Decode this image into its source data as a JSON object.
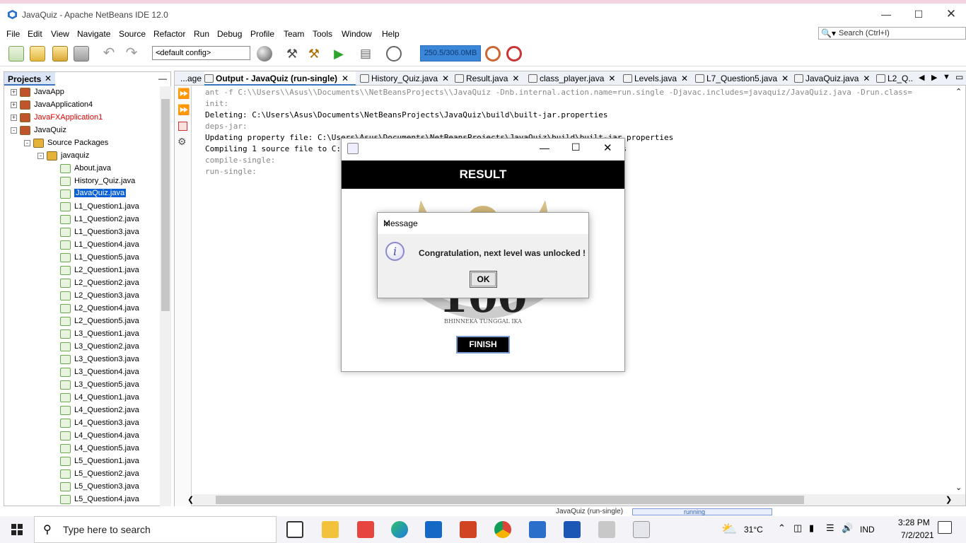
{
  "window": {
    "title": "JavaQuiz - Apache NetBeans IDE 12.0"
  },
  "menu": [
    "File",
    "Edit",
    "View",
    "Navigate",
    "Source",
    "Refactor",
    "Run",
    "Debug",
    "Profile",
    "Team",
    "Tools",
    "Window",
    "Help"
  ],
  "search": {
    "placeholder": "Search (Ctrl+I)"
  },
  "toolbar": {
    "config": "<default config>",
    "memory": "250.5/306.0MB"
  },
  "projects": {
    "tab_label": "Projects",
    "items": [
      {
        "label": "JavaApp",
        "level": 0,
        "expander": "+",
        "color": "#000000"
      },
      {
        "label": "JavaApplication4",
        "level": 0,
        "expander": "+",
        "color": "#000000"
      },
      {
        "label": "JavaFXApplication1",
        "level": 0,
        "expander": "+",
        "color": "#e00000"
      },
      {
        "label": "JavaQuiz",
        "level": 0,
        "expander": "-",
        "color": "#000000"
      },
      {
        "label": "Source Packages",
        "level": 1,
        "expander": "-",
        "color": "#000000"
      },
      {
        "label": "javaquiz",
        "level": 2,
        "expander": "-",
        "color": "#000000"
      },
      {
        "label": "About.java",
        "level": 3,
        "expander": "",
        "color": "#000000"
      },
      {
        "label": "History_Quiz.java",
        "level": 3,
        "expander": "",
        "color": "#000000"
      },
      {
        "label": "JavaQuiz.java",
        "level": 3,
        "expander": "",
        "color": "#000000",
        "selected": true
      },
      {
        "label": "L1_Question1.java",
        "level": 3,
        "expander": "",
        "color": "#000000"
      },
      {
        "label": "L1_Question2.java",
        "level": 3,
        "expander": "",
        "color": "#000000"
      },
      {
        "label": "L1_Question3.java",
        "level": 3,
        "expander": "",
        "color": "#000000"
      },
      {
        "label": "L1_Question4.java",
        "level": 3,
        "expander": "",
        "color": "#000000"
      },
      {
        "label": "L1_Question5.java",
        "level": 3,
        "expander": "",
        "color": "#000000"
      },
      {
        "label": "L2_Question1.java",
        "level": 3,
        "expander": "",
        "color": "#000000"
      },
      {
        "label": "L2_Question2.java",
        "level": 3,
        "expander": "",
        "color": "#000000"
      },
      {
        "label": "L2_Question3.java",
        "level": 3,
        "expander": "",
        "color": "#000000"
      },
      {
        "label": "L2_Question4.java",
        "level": 3,
        "expander": "",
        "color": "#000000"
      },
      {
        "label": "L2_Question5.java",
        "level": 3,
        "expander": "",
        "color": "#000000"
      },
      {
        "label": "L3_Question1.java",
        "level": 3,
        "expander": "",
        "color": "#000000"
      },
      {
        "label": "L3_Question2.java",
        "level": 3,
        "expander": "",
        "color": "#000000"
      },
      {
        "label": "L3_Question3.java",
        "level": 3,
        "expander": "",
        "color": "#000000"
      },
      {
        "label": "L3_Question4.java",
        "level": 3,
        "expander": "",
        "color": "#000000"
      },
      {
        "label": "L3_Question5.java",
        "level": 3,
        "expander": "",
        "color": "#000000"
      },
      {
        "label": "L4_Question1.java",
        "level": 3,
        "expander": "",
        "color": "#000000"
      },
      {
        "label": "L4_Question2.java",
        "level": 3,
        "expander": "",
        "color": "#000000"
      },
      {
        "label": "L4_Question3.java",
        "level": 3,
        "expander": "",
        "color": "#000000"
      },
      {
        "label": "L4_Question4.java",
        "level": 3,
        "expander": "",
        "color": "#000000"
      },
      {
        "label": "L4_Question5.java",
        "level": 3,
        "expander": "",
        "color": "#000000"
      },
      {
        "label": "L5_Question1.java",
        "level": 3,
        "expander": "",
        "color": "#000000"
      },
      {
        "label": "L5_Question2.java",
        "level": 3,
        "expander": "",
        "color": "#000000"
      },
      {
        "label": "L5_Question3.java",
        "level": 3,
        "expander": "",
        "color": "#000000"
      },
      {
        "label": "L5_Question4.java",
        "level": 3,
        "expander": "",
        "color": "#000000"
      }
    ]
  },
  "editor_tabs": [
    {
      "label": "...age"
    },
    {
      "label": "Output - JavaQuiz (run-single)",
      "active": true
    },
    {
      "label": "History_Quiz.java"
    },
    {
      "label": "Result.java"
    },
    {
      "label": "class_player.java"
    },
    {
      "label": "Levels.java"
    },
    {
      "label": "L7_Question5.java"
    },
    {
      "label": "JavaQuiz.java"
    },
    {
      "label": "L2_Q..."
    }
  ],
  "output": {
    "lines": [
      {
        "text": "ant -f C:\\\\Users\\\\Asus\\\\Documents\\\\NetBeansProjects\\\\JavaQuiz -Dnb.internal.action.name=run.single -Djavac.includes=javaquiz/JavaQuiz.java -Drun.class=",
        "gray": true
      },
      {
        "text": "init:",
        "gray": true
      },
      {
        "text": "Deleting: C:\\Users\\Asus\\Documents\\NetBeansProjects\\JavaQuiz\\build\\built-jar.properties",
        "gray": false
      },
      {
        "text": "deps-jar:",
        "gray": true
      },
      {
        "text": "Updating property file: C:\\Users\\Asus\\Documents\\NetBeansProjects\\JavaQuiz\\build\\built-jar.properties",
        "gray": false
      },
      {
        "text": "Compiling 1 source file to C:\\Users\\Asus\\Documents\\NetBeansProjects\\JavaQuiz\\build\\classes",
        "gray": false
      },
      {
        "text": "compile-single:",
        "gray": true
      },
      {
        "text": "run-single:",
        "gray": true
      }
    ]
  },
  "result_window": {
    "header": "RESULT",
    "score": "100",
    "motto": "BHINNEKA TUNGGAL IKA",
    "finish_label": "FINISH"
  },
  "message_dialog": {
    "title": "Message",
    "text": "Congratulation, next level was unlocked !",
    "ok_label": "OK"
  },
  "statusbar": {
    "task": "JavaQuiz (run-single)",
    "state": "running"
  },
  "taskbar": {
    "search_placeholder": "Type here to search",
    "temperature": "31°C",
    "language": "IND",
    "time": "3:28 PM",
    "date": "7/2/2021"
  }
}
